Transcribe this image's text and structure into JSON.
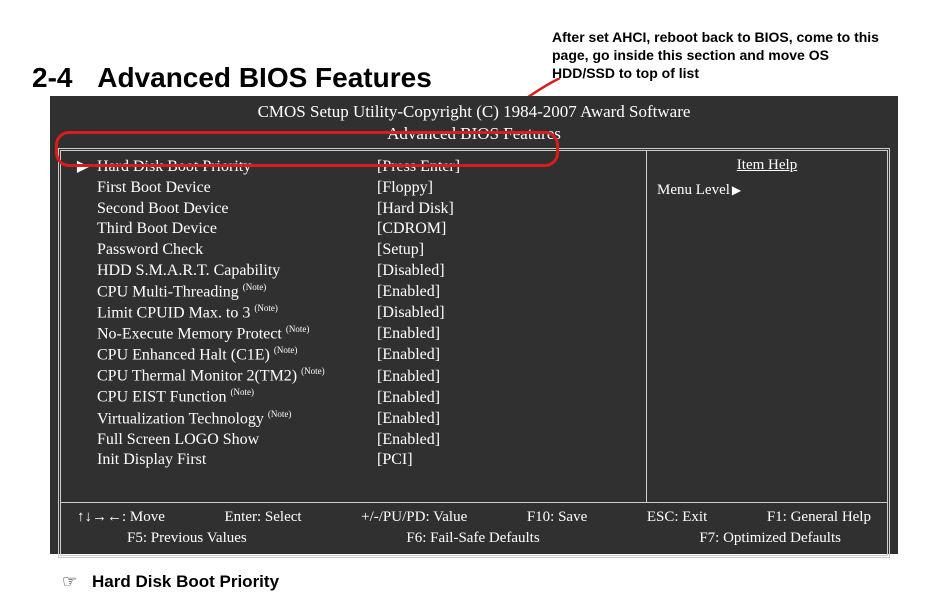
{
  "section": {
    "number": "2-4",
    "title": "Advanced BIOS Features"
  },
  "annotation": {
    "line1": "After set AHCI, reboot back to BIOS, come to this",
    "line2": "page, go inside this section and move OS",
    "line3": "HDD/SSD to top of list"
  },
  "bios": {
    "header": "CMOS Setup Utility-Copyright (C) 1984-2007 Award Software",
    "subheader": "Advanced BIOS Features",
    "rows": [
      {
        "marker": "▶",
        "label": "Hard Disk Boot Priority",
        "note": "",
        "value": "[Press Enter]"
      },
      {
        "marker": "",
        "label": "First Boot Device",
        "note": "",
        "value": "[Floppy]"
      },
      {
        "marker": "",
        "label": "Second Boot Device",
        "note": "",
        "value": "[Hard Disk]"
      },
      {
        "marker": "",
        "label": "Third Boot Device",
        "note": "",
        "value": "[CDROM]"
      },
      {
        "marker": "",
        "label": "Password Check",
        "note": "",
        "value": "[Setup]"
      },
      {
        "marker": "",
        "label": "HDD S.M.A.R.T. Capability",
        "note": "",
        "value": "[Disabled]"
      },
      {
        "marker": "",
        "label": "CPU Multi-Threading",
        "note": "(Note)",
        "value": "[Enabled]"
      },
      {
        "marker": "",
        "label": "Limit CPUID Max. to 3",
        "note": "(Note)",
        "value": "[Disabled]"
      },
      {
        "marker": "",
        "label": "No-Execute Memory Protect",
        "note": "(Note)",
        "value": "[Enabled]"
      },
      {
        "marker": "",
        "label": "CPU Enhanced Halt (C1E)",
        "note": "(Note)",
        "value": "[Enabled]"
      },
      {
        "marker": "",
        "label": "CPU Thermal Monitor 2(TM2)",
        "note": "(Note)",
        "value": "[Enabled]"
      },
      {
        "marker": "",
        "label": "CPU EIST Function",
        "note": "(Note)",
        "value": "[Enabled]"
      },
      {
        "marker": "",
        "label": "Virtualization Technology",
        "note": "(Note)",
        "value": "[Enabled]"
      },
      {
        "marker": "",
        "label": "Full Screen LOGO Show",
        "note": "",
        "value": "[Enabled]"
      },
      {
        "marker": "",
        "label": "Init Display First",
        "note": "",
        "value": "[PCI]"
      }
    ],
    "help_title": "Item Help",
    "menu_level": "Menu Level",
    "footer": {
      "line1": {
        "move": "↑↓→←: Move",
        "enter": "Enter: Select",
        "value": "+/-/PU/PD: Value",
        "save": "F10: Save",
        "esc": "ESC: Exit",
        "help": "F1: General Help"
      },
      "line2": {
        "prev": "F5: Previous Values",
        "failsafe": "F6: Fail-Safe Defaults",
        "optimized": "F7: Optimized Defaults"
      }
    }
  },
  "bottom": {
    "label": "Hard Disk Boot Priority"
  }
}
